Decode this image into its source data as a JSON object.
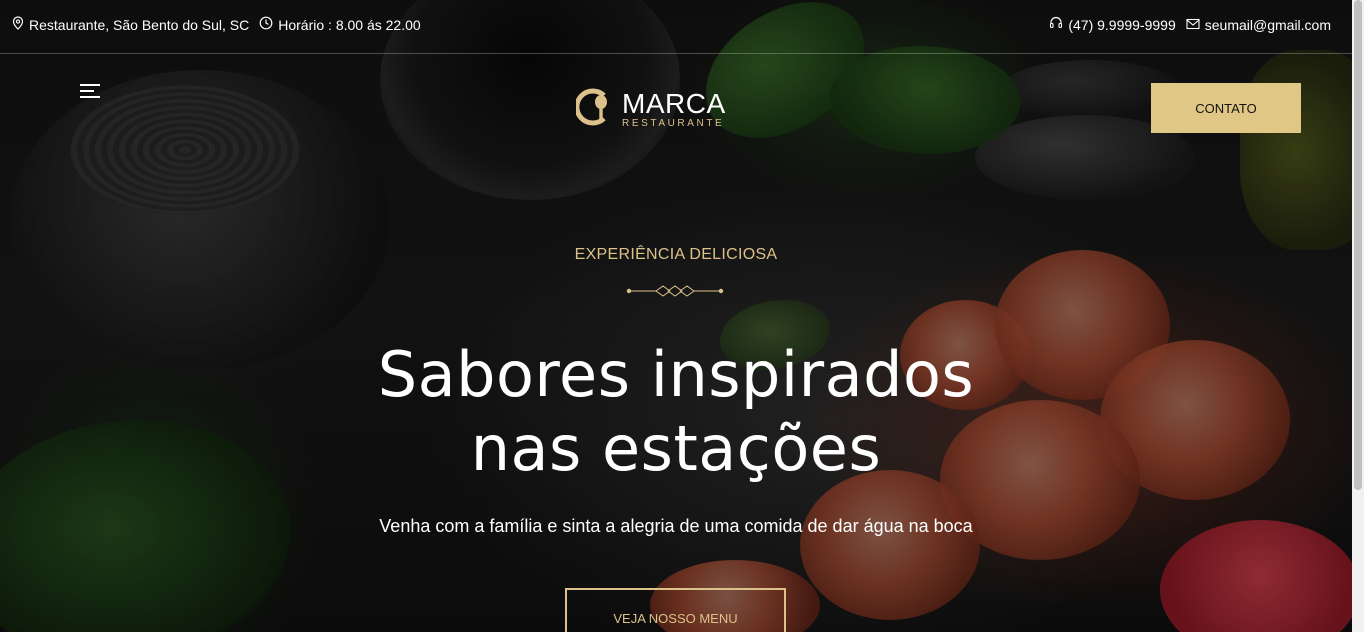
{
  "topbar": {
    "location": "Restaurante, São Bento do Sul, SC",
    "hours": "Horário : 8.00 ás 22.00",
    "phone": "(47) 9.9999-9999",
    "email": "seumail@gmail.com",
    "icons": {
      "location": "map-pin-icon",
      "hours": "clock-icon",
      "phone": "headset-icon",
      "email": "envelope-icon"
    }
  },
  "header": {
    "menu_icon": "hamburger-icon",
    "logo": {
      "name": "MARCA",
      "subtitle": "RESTAURANTE",
      "icon": "plate-spoon-icon"
    },
    "contact_label": "CONTATO"
  },
  "hero": {
    "eyebrow": "EXPERIÊNCIA DELICIOSA",
    "headline_line1": "Sabores inspirados",
    "headline_line2": "nas estações",
    "subtitle": "Venha com a família e sinta a alegria de uma comida de dar água na boca",
    "cta_label": "VEJA NOSSO MENU"
  },
  "colors": {
    "accent": "#dcc28a",
    "button_bg": "#e0c785",
    "text": "#ffffff",
    "background": "#151515"
  }
}
